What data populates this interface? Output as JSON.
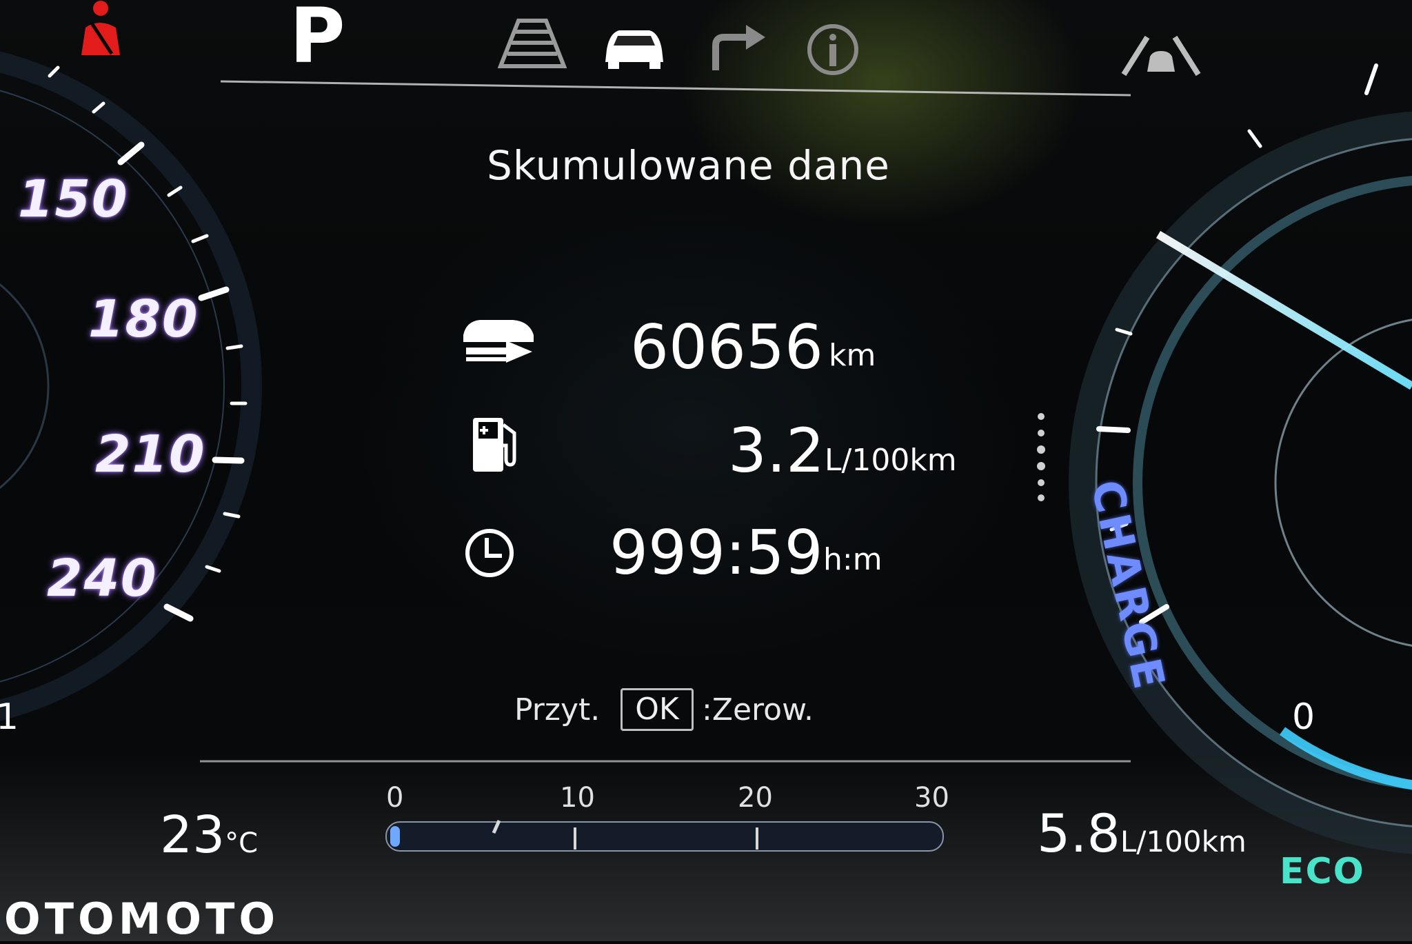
{
  "header": {
    "gear": "P",
    "icons": [
      "lane-assist-icon",
      "car-icon",
      "turn-arrow-icon",
      "info-icon",
      "forward-collision-icon"
    ],
    "warning_icon": "seatbelt-warning-icon"
  },
  "screen": {
    "title": "Skumulowane dane",
    "rows": [
      {
        "icon": "distance-car-icon",
        "value": "60656",
        "unit": "km"
      },
      {
        "icon": "fuel-pump-icon",
        "value": "3.2",
        "unit": "L/100km"
      },
      {
        "icon": "clock-icon",
        "value": "999:59",
        "unit": "h:m"
      }
    ],
    "hint": {
      "prefix": "Przyt.",
      "key": "OK",
      "suffix": ":Zerow."
    }
  },
  "bottom_bar": {
    "temperature": {
      "value": "23",
      "unit": "°C"
    },
    "scale_labels": [
      "0",
      "10",
      "20",
      "30"
    ],
    "avg_consumption": {
      "value": "5.8",
      "unit": "L/100km"
    },
    "mode": "ECO"
  },
  "speedometer": {
    "labels": [
      "150",
      "180",
      "210",
      "240"
    ],
    "edge_label": "1"
  },
  "power_gauge": {
    "label": "CHARGE",
    "zero_label": "0"
  },
  "watermark": "OTOMOTO",
  "colors": {
    "gauge_purple": "#a27cff",
    "eco_teal": "#48e3c8",
    "charge_blue": "#6f8cff",
    "warning_red": "#e21b1b"
  }
}
